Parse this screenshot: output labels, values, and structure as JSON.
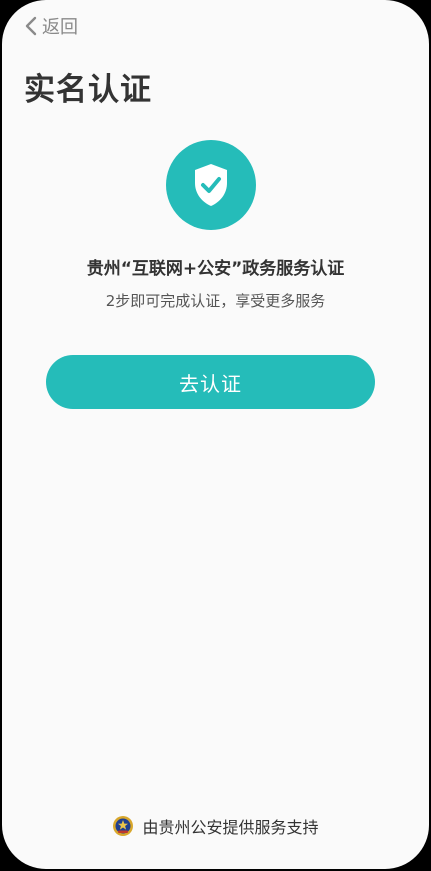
{
  "nav": {
    "back_icon": "chevron-left-icon",
    "back_label": "返回"
  },
  "page": {
    "title": "实名认证"
  },
  "hero": {
    "icon": "shield-check-icon",
    "headline": "贵州“互联网+公安”政务服务认证",
    "subline": "2步即可完成认证，享受更多服务"
  },
  "action": {
    "button_label": "去认证"
  },
  "footer": {
    "icon": "police-emblem-icon",
    "text": "由贵州公安提供服务支持"
  },
  "colors": {
    "accent": "#25bcb9",
    "background": "#fafafa",
    "title_text": "#333333",
    "muted_text": "#8a8a8a"
  }
}
